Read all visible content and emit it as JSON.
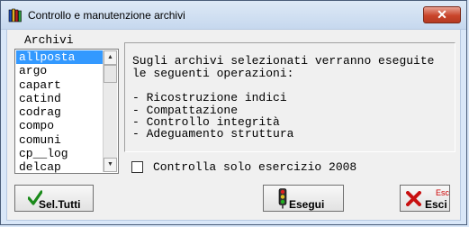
{
  "window": {
    "title": "Controllo e manutenzione archivi",
    "close_label": "✕"
  },
  "archivi": {
    "label": "Archivi",
    "items": [
      {
        "label": "allposta",
        "selected": true
      },
      {
        "label": "argo",
        "selected": false
      },
      {
        "label": "capart",
        "selected": false
      },
      {
        "label": "catind",
        "selected": false
      },
      {
        "label": "codrag",
        "selected": false
      },
      {
        "label": "compo",
        "selected": false
      },
      {
        "label": "comuni",
        "selected": false
      },
      {
        "label": "cp__log",
        "selected": false
      },
      {
        "label": "delcap",
        "selected": false
      }
    ]
  },
  "info": {
    "line1": "Sugli archivi selezionati verranno eseguite",
    "line2": "le seguenti operazioni:",
    "ops": [
      "- Ricostruzione indici",
      "- Compattazione",
      "- Controllo integrità",
      "- Adeguamento struttura"
    ]
  },
  "checkbox": {
    "label": "Controlla solo esercizio 2008",
    "checked": false
  },
  "buttons": {
    "seltutti_label": "Sel.Tutti",
    "esegui_label": "Esegui",
    "esci_label": "Esci",
    "esci_shortcut": "Esc"
  },
  "icons": {
    "app": "archive-books-icon",
    "seltutti": "checkmark-icon",
    "esegui": "traffic-light-icon",
    "esci": "red-x-icon"
  }
}
